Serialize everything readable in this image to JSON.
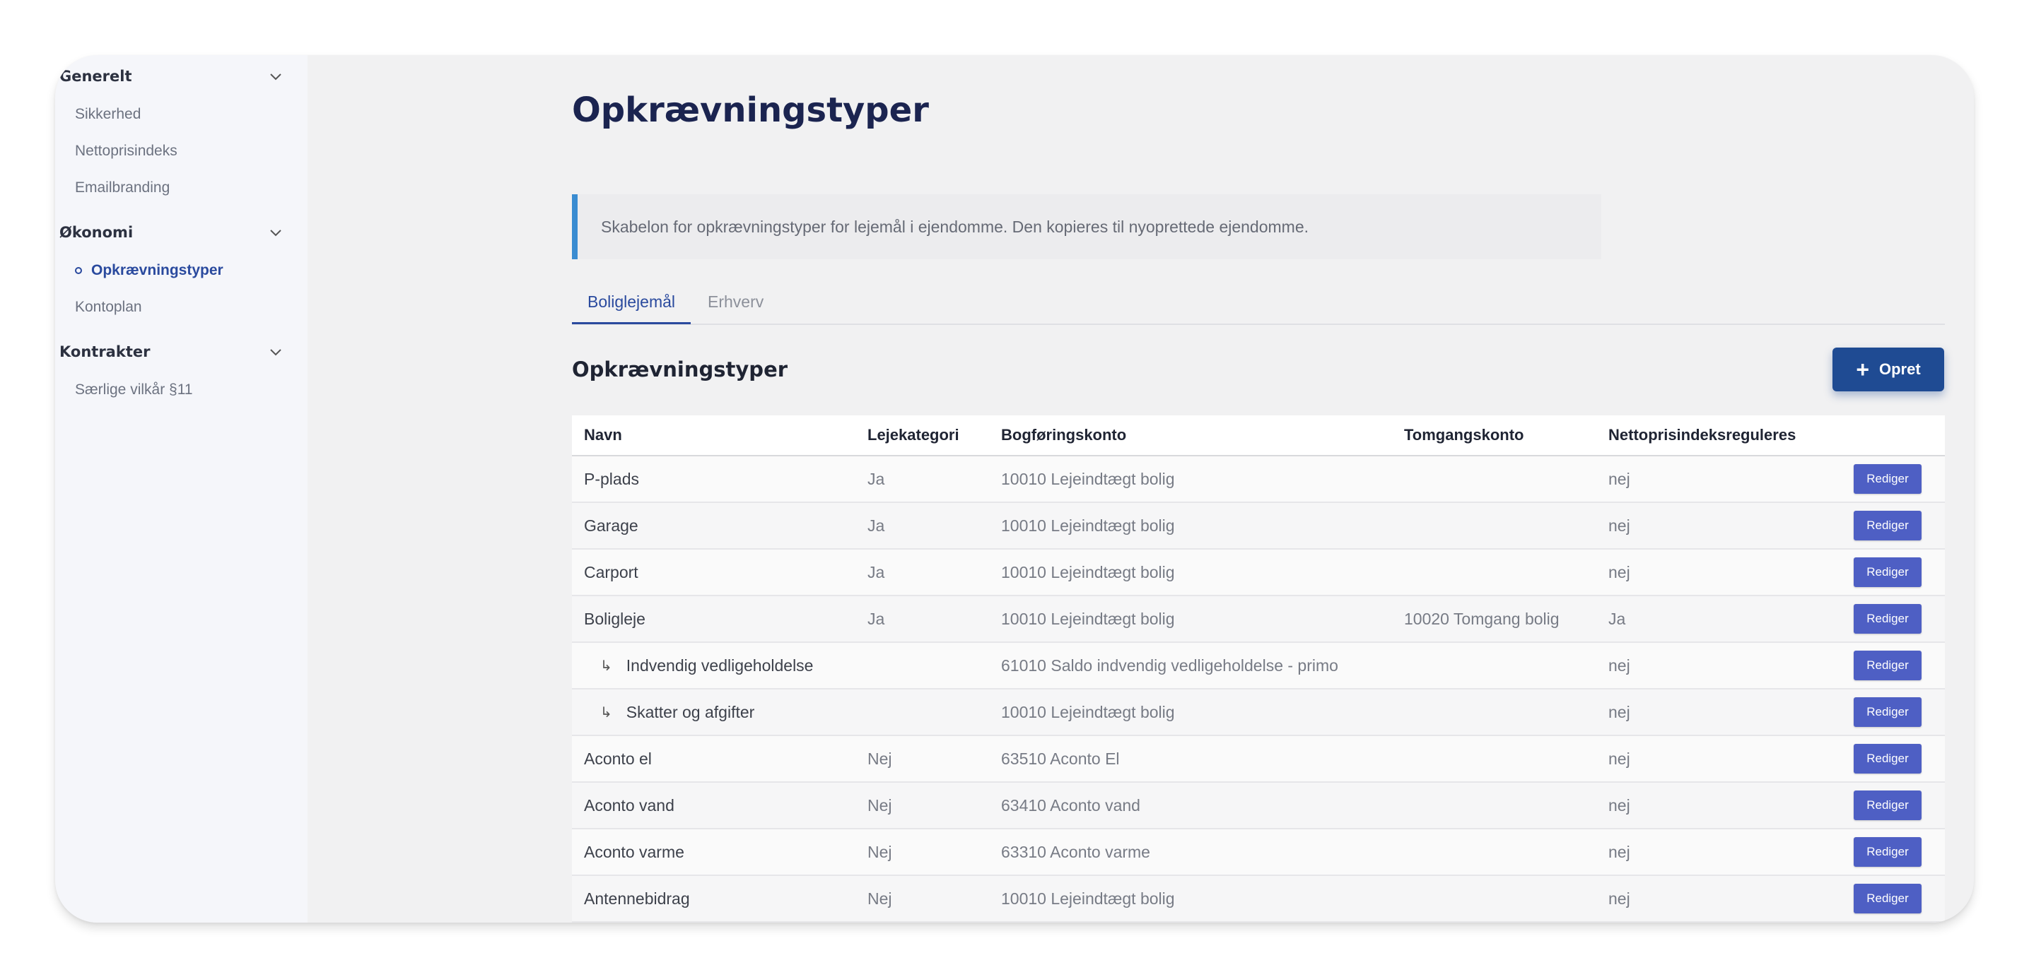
{
  "sidebar": {
    "groups": [
      {
        "label": "Generelt",
        "items": [
          "Sikkerhed",
          "Nettoprisindeks",
          "Emailbranding"
        ]
      },
      {
        "label": "Økonomi",
        "items": [
          "Opkrævningstyper",
          "Kontoplan"
        ]
      },
      {
        "label": "Kontrakter",
        "items": [
          "Særlige vilkår §11"
        ]
      }
    ],
    "active_item": "Opkrævningstyper"
  },
  "page": {
    "title": "Opkrævningstyper",
    "info": "Skabelon for opkrævningstyper for lejemål i ejendomme. Den kopieres til nyoprettede ejendomme."
  },
  "tabs": [
    {
      "label": "Boliglejemål",
      "active": true
    },
    {
      "label": "Erhverv",
      "active": false
    }
  ],
  "section": {
    "title": "Opkrævningstyper",
    "create_label": "Opret"
  },
  "table": {
    "columns": [
      "Navn",
      "Lejekategori",
      "Bogføringskonto",
      "Tomgangskonto",
      "Nettoprisindeksreguleres"
    ],
    "edit_label": "Rediger",
    "rows": [
      {
        "name": "P-plads",
        "sub": false,
        "kategori": "Ja",
        "bogforing": "10010 Lejeindtægt bolig",
        "tomgang": "",
        "netto": "nej"
      },
      {
        "name": "Garage",
        "sub": false,
        "kategori": "Ja",
        "bogforing": "10010 Lejeindtægt bolig",
        "tomgang": "",
        "netto": "nej"
      },
      {
        "name": "Carport",
        "sub": false,
        "kategori": "Ja",
        "bogforing": "10010 Lejeindtægt bolig",
        "tomgang": "",
        "netto": "nej"
      },
      {
        "name": "Boligleje",
        "sub": false,
        "kategori": "Ja",
        "bogforing": "10010 Lejeindtægt bolig",
        "tomgang": "10020 Tomgang bolig",
        "netto": "Ja"
      },
      {
        "name": "Indvendig vedligeholdelse",
        "sub": true,
        "kategori": "",
        "bogforing": "61010 Saldo indvendig vedligeholdelse - primo",
        "tomgang": "",
        "netto": "nej"
      },
      {
        "name": "Skatter og afgifter",
        "sub": true,
        "kategori": "",
        "bogforing": "10010 Lejeindtægt bolig",
        "tomgang": "",
        "netto": "nej"
      },
      {
        "name": "Aconto el",
        "sub": false,
        "kategori": "Nej",
        "bogforing": "63510 Aconto El",
        "tomgang": "",
        "netto": "nej"
      },
      {
        "name": "Aconto vand",
        "sub": false,
        "kategori": "Nej",
        "bogforing": "63410 Aconto vand",
        "tomgang": "",
        "netto": "nej"
      },
      {
        "name": "Aconto varme",
        "sub": false,
        "kategori": "Nej",
        "bogforing": "63310 Aconto varme",
        "tomgang": "",
        "netto": "nej"
      },
      {
        "name": "Antennebidrag",
        "sub": false,
        "kategori": "Nej",
        "bogforing": "10010 Lejeindtægt bolig",
        "tomgang": "",
        "netto": "nej"
      }
    ]
  },
  "colors": {
    "accent": "#2a4a9e",
    "primary_button": "#1f4b93",
    "edit_button": "#4e5fc4",
    "info_border": "#3a8cd1"
  }
}
